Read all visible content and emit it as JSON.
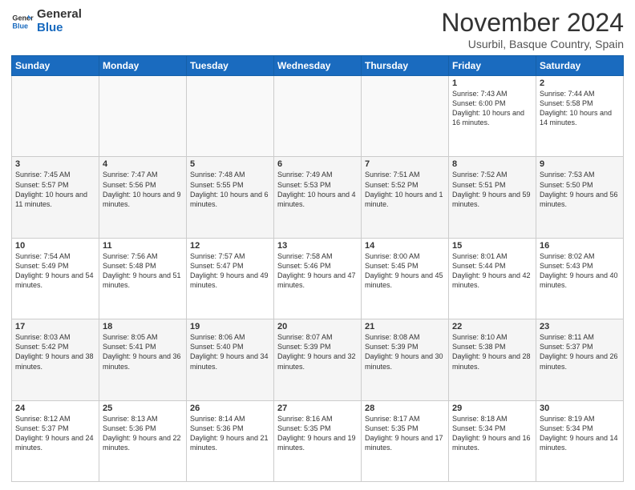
{
  "logo": {
    "line1": "General",
    "line2": "Blue"
  },
  "header": {
    "month_title": "November 2024",
    "location": "Usurbil, Basque Country, Spain"
  },
  "days_of_week": [
    "Sunday",
    "Monday",
    "Tuesday",
    "Wednesday",
    "Thursday",
    "Friday",
    "Saturday"
  ],
  "weeks": [
    [
      {
        "day": "",
        "info": "",
        "empty": true
      },
      {
        "day": "",
        "info": "",
        "empty": true
      },
      {
        "day": "",
        "info": "",
        "empty": true
      },
      {
        "day": "",
        "info": "",
        "empty": true
      },
      {
        "day": "",
        "info": "",
        "empty": true
      },
      {
        "day": "1",
        "info": "Sunrise: 7:43 AM\nSunset: 6:00 PM\nDaylight: 10 hours and 16 minutes."
      },
      {
        "day": "2",
        "info": "Sunrise: 7:44 AM\nSunset: 5:58 PM\nDaylight: 10 hours and 14 minutes."
      }
    ],
    [
      {
        "day": "3",
        "info": "Sunrise: 7:45 AM\nSunset: 5:57 PM\nDaylight: 10 hours and 11 minutes."
      },
      {
        "day": "4",
        "info": "Sunrise: 7:47 AM\nSunset: 5:56 PM\nDaylight: 10 hours and 9 minutes."
      },
      {
        "day": "5",
        "info": "Sunrise: 7:48 AM\nSunset: 5:55 PM\nDaylight: 10 hours and 6 minutes."
      },
      {
        "day": "6",
        "info": "Sunrise: 7:49 AM\nSunset: 5:53 PM\nDaylight: 10 hours and 4 minutes."
      },
      {
        "day": "7",
        "info": "Sunrise: 7:51 AM\nSunset: 5:52 PM\nDaylight: 10 hours and 1 minute."
      },
      {
        "day": "8",
        "info": "Sunrise: 7:52 AM\nSunset: 5:51 PM\nDaylight: 9 hours and 59 minutes."
      },
      {
        "day": "9",
        "info": "Sunrise: 7:53 AM\nSunset: 5:50 PM\nDaylight: 9 hours and 56 minutes."
      }
    ],
    [
      {
        "day": "10",
        "info": "Sunrise: 7:54 AM\nSunset: 5:49 PM\nDaylight: 9 hours and 54 minutes."
      },
      {
        "day": "11",
        "info": "Sunrise: 7:56 AM\nSunset: 5:48 PM\nDaylight: 9 hours and 51 minutes."
      },
      {
        "day": "12",
        "info": "Sunrise: 7:57 AM\nSunset: 5:47 PM\nDaylight: 9 hours and 49 minutes."
      },
      {
        "day": "13",
        "info": "Sunrise: 7:58 AM\nSunset: 5:46 PM\nDaylight: 9 hours and 47 minutes."
      },
      {
        "day": "14",
        "info": "Sunrise: 8:00 AM\nSunset: 5:45 PM\nDaylight: 9 hours and 45 minutes."
      },
      {
        "day": "15",
        "info": "Sunrise: 8:01 AM\nSunset: 5:44 PM\nDaylight: 9 hours and 42 minutes."
      },
      {
        "day": "16",
        "info": "Sunrise: 8:02 AM\nSunset: 5:43 PM\nDaylight: 9 hours and 40 minutes."
      }
    ],
    [
      {
        "day": "17",
        "info": "Sunrise: 8:03 AM\nSunset: 5:42 PM\nDaylight: 9 hours and 38 minutes."
      },
      {
        "day": "18",
        "info": "Sunrise: 8:05 AM\nSunset: 5:41 PM\nDaylight: 9 hours and 36 minutes."
      },
      {
        "day": "19",
        "info": "Sunrise: 8:06 AM\nSunset: 5:40 PM\nDaylight: 9 hours and 34 minutes."
      },
      {
        "day": "20",
        "info": "Sunrise: 8:07 AM\nSunset: 5:39 PM\nDaylight: 9 hours and 32 minutes."
      },
      {
        "day": "21",
        "info": "Sunrise: 8:08 AM\nSunset: 5:39 PM\nDaylight: 9 hours and 30 minutes."
      },
      {
        "day": "22",
        "info": "Sunrise: 8:10 AM\nSunset: 5:38 PM\nDaylight: 9 hours and 28 minutes."
      },
      {
        "day": "23",
        "info": "Sunrise: 8:11 AM\nSunset: 5:37 PM\nDaylight: 9 hours and 26 minutes."
      }
    ],
    [
      {
        "day": "24",
        "info": "Sunrise: 8:12 AM\nSunset: 5:37 PM\nDaylight: 9 hours and 24 minutes."
      },
      {
        "day": "25",
        "info": "Sunrise: 8:13 AM\nSunset: 5:36 PM\nDaylight: 9 hours and 22 minutes."
      },
      {
        "day": "26",
        "info": "Sunrise: 8:14 AM\nSunset: 5:36 PM\nDaylight: 9 hours and 21 minutes."
      },
      {
        "day": "27",
        "info": "Sunrise: 8:16 AM\nSunset: 5:35 PM\nDaylight: 9 hours and 19 minutes."
      },
      {
        "day": "28",
        "info": "Sunrise: 8:17 AM\nSunset: 5:35 PM\nDaylight: 9 hours and 17 minutes."
      },
      {
        "day": "29",
        "info": "Sunrise: 8:18 AM\nSunset: 5:34 PM\nDaylight: 9 hours and 16 minutes."
      },
      {
        "day": "30",
        "info": "Sunrise: 8:19 AM\nSunset: 5:34 PM\nDaylight: 9 hours and 14 minutes."
      }
    ]
  ]
}
